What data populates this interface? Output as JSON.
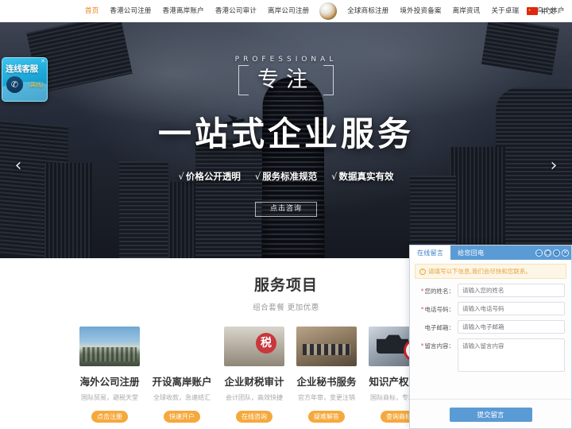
{
  "nav": {
    "items": [
      {
        "label": "首页",
        "active": true
      },
      {
        "label": "香港公司注册",
        "active": false
      },
      {
        "label": "香港离岸账户",
        "active": false
      },
      {
        "label": "香港公司审计",
        "active": false
      },
      {
        "label": "离岸公司注册",
        "active": false
      }
    ],
    "items_right": [
      {
        "label": "全球商标注册"
      },
      {
        "label": "境外投资备案"
      },
      {
        "label": "离岸资讯"
      },
      {
        "label": "关于卓瑞"
      },
      {
        "label": "义乌个体户"
      }
    ],
    "logo_icon": "sphere-logo-icon",
    "language": "中文",
    "flag_icon": "china-flag-icon",
    "caret_icon": "chevron-down-icon",
    "accent_color": "#e8820c"
  },
  "hero": {
    "eyebrow": "PROFESSIONAL",
    "focus_word": "专注",
    "headline": "一站式企业服务",
    "features": [
      {
        "tick": "√",
        "label": "价格公开透明"
      },
      {
        "tick": "√",
        "label": "服务标准规范"
      },
      {
        "tick": "√",
        "label": "数据真实有效"
      }
    ],
    "cta_label": "点击咨询",
    "prev_icon": "chevron-left-icon",
    "next_icon": "chevron-right-icon"
  },
  "livechat": {
    "title": "连线客服",
    "status": "(离线)",
    "phone_icon": "phone-icon",
    "close_icon": "close-icon"
  },
  "services": {
    "title": "服务项目",
    "subtitle": "组合套餐 更加优惠",
    "cards": [
      {
        "title": "海外公司注册",
        "desc": "国际贸易，避税天堂",
        "button": "点击注册",
        "image": "harbor-city-image"
      },
      {
        "title": "开设离岸账户",
        "desc": "全球收款，急速结汇",
        "button": "快速开户",
        "image": "credit-card-image"
      },
      {
        "title": "企业财税审计",
        "desc": "会计团队，高效快捷",
        "button": "在线咨询",
        "image": "tax-seal-image"
      },
      {
        "title": "企业秘书服务",
        "desc": "官方年审，变更注销",
        "button": "疑难解答",
        "image": "office-desk-image"
      },
      {
        "title": "知识产权服务",
        "desc": "国际商标，专利版权",
        "button": "查询商标",
        "image": "trademark-r-image"
      }
    ],
    "button_color": "#f5a93c"
  },
  "chat_panel": {
    "tabs": [
      {
        "label": "在线留言",
        "active": true
      },
      {
        "label": "给您回电",
        "active": false
      }
    ],
    "controls": [
      {
        "name": "minimize-control",
        "glyph": "—"
      },
      {
        "name": "restore-control",
        "glyph": "□"
      },
      {
        "name": "collapse-control",
        "glyph": "–"
      },
      {
        "name": "close-control",
        "glyph": "✕"
      }
    ],
    "notice": "请填写以下信息,我们会尽快和您联系。",
    "notice_icon": "info-icon",
    "fields": [
      {
        "label": "您的姓名：",
        "placeholder": "请输入您的姓名",
        "required": true,
        "type": "text"
      },
      {
        "label": "电话号码：",
        "placeholder": "请输入电话号码",
        "required": true,
        "type": "text"
      },
      {
        "label": "电子邮箱：",
        "placeholder": "请输入电子邮箱",
        "required": false,
        "type": "text"
      },
      {
        "label": "留言内容：",
        "placeholder": "请输入留言内容",
        "required": true,
        "type": "textarea"
      }
    ],
    "submit_label": "提交留言",
    "header_color": "#5b9bd5"
  }
}
